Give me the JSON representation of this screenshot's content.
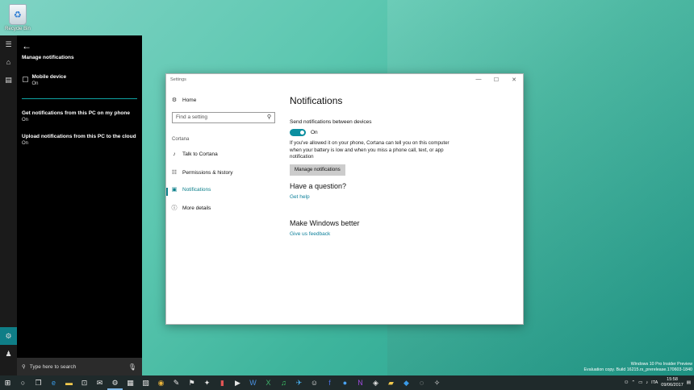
{
  "desktop": {
    "recycle_bin_label": "Recycle Bin"
  },
  "cortana": {
    "title": "Manage notifications",
    "device": {
      "name": "Mobile device",
      "status": "On"
    },
    "options": [
      {
        "label": "Get notifications from this PC on my phone",
        "status": "On"
      },
      {
        "label": "Upload notifications from this PC to the cloud",
        "status": "On"
      }
    ],
    "search_placeholder": "Type here to search"
  },
  "settings": {
    "window_title": "Settings",
    "search_placeholder": "Find a setting",
    "nav": {
      "home": "Home",
      "category": "Cortana",
      "items": [
        {
          "label": "Talk to Cortana",
          "icon": "microphone-icon"
        },
        {
          "label": "Permissions & history",
          "icon": "permissions-icon"
        },
        {
          "label": "Notifications",
          "icon": "notifications-icon",
          "selected": true
        },
        {
          "label": "More details",
          "icon": "info-icon"
        }
      ]
    },
    "page": {
      "title": "Notifications",
      "send_label": "Send notifications between devices",
      "toggle_state": "On",
      "description": "If you've allowed it on your phone, Cortana can tell you on this computer when your battery is low and when you miss a phone call, text, or app notification",
      "manage_button": "Manage notifications",
      "question_heading": "Have a question?",
      "get_help": "Get help",
      "better_heading": "Make Windows better",
      "feedback": "Give us feedback"
    }
  },
  "watermark": {
    "line1": "Windows 10 Pro Insider Preview",
    "line2": "Evaluation copy. Build 16215.rs_prerelease.170603-1840"
  },
  "taskbar": {
    "language": "ITA",
    "time": "15:58",
    "date": "09/06/2017"
  },
  "colors": {
    "accent": "#0b7f8a",
    "toggle_on": "#0b8fa0"
  }
}
